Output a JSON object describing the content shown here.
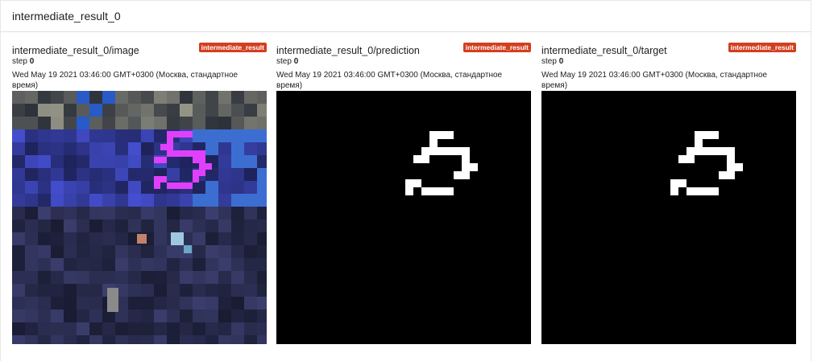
{
  "group": {
    "title": "intermediate_result_0"
  },
  "cards": [
    {
      "title": "intermediate_result_0/image",
      "tag": "intermediate_result",
      "step_label": "step ",
      "step_value": "0",
      "timestamp": "Wed May 19 2021 03:46:00 GMT+0300 (Москва, стандартное время)"
    },
    {
      "title": "intermediate_result_0/prediction",
      "tag": "intermediate_result",
      "step_label": "step ",
      "step_value": "0",
      "timestamp": "Wed May 19 2021 03:46:00 GMT+0300 (Москва, стандартное время)"
    },
    {
      "title": "intermediate_result_0/target",
      "tag": "intermediate_result",
      "step_label": "step ",
      "step_value": "0",
      "timestamp": "Wed May 19 2021 03:46:00 GMT+0300 (Москва, стандартное время)"
    }
  ],
  "colors": {
    "tag_bg": "#d23f1f",
    "mask_pixel": "#ffffff",
    "overlay_pixel": "#e040fb"
  }
}
